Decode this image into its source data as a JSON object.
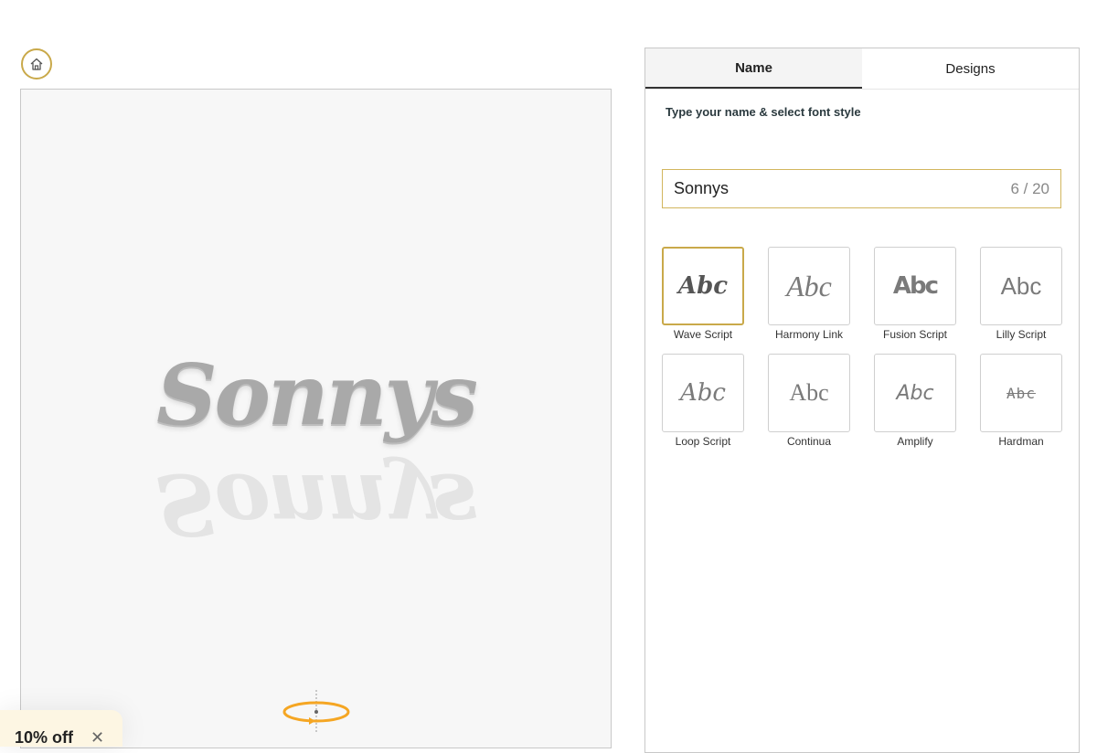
{
  "preview": {
    "name_text": "Sonnys"
  },
  "banner": {
    "text": "10% off",
    "close_glyph": "✕"
  },
  "tabs": [
    {
      "label": "Name",
      "active": true
    },
    {
      "label": "Designs",
      "active": false
    }
  ],
  "instruction": "Type your name & select font style",
  "name_input": {
    "value": "Sonnys",
    "counter": "6 / 20"
  },
  "fonts": [
    {
      "sample": "Abc",
      "label": "Wave Script",
      "selected": true
    },
    {
      "sample": "Abc",
      "label": "Harmony Link",
      "selected": false
    },
    {
      "sample": "Abc",
      "label": "Fusion Script",
      "selected": false
    },
    {
      "sample": "Abc",
      "label": "Lilly Script",
      "selected": false
    },
    {
      "sample": "Abc",
      "label": "Loop Script",
      "selected": false
    },
    {
      "sample": "Abc",
      "label": "Continua",
      "selected": false
    },
    {
      "sample": "Abc",
      "label": "Amplify",
      "selected": false
    },
    {
      "sample": "Abc",
      "label": "Hardman",
      "selected": false
    }
  ],
  "colors": {
    "accent_gold": "#c9a94a",
    "rotate_orange": "#f5a623",
    "banner_bg": "#fdf6e3"
  },
  "icons": {
    "home": "home-icon",
    "rotate": "rotate-360-icon",
    "close": "close-icon"
  }
}
